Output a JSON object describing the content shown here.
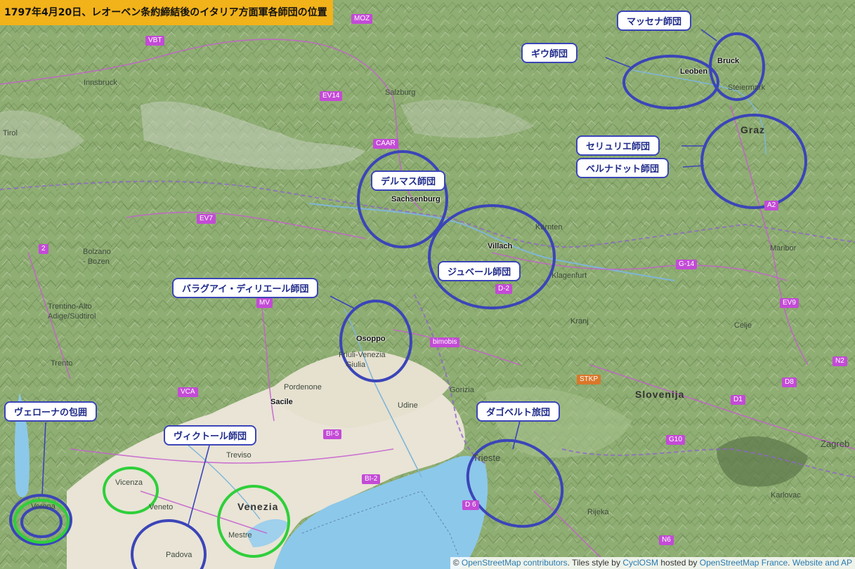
{
  "title": "1797年4月20日、レオーベン条約締結後のイタリア方面軍各師団の位置",
  "callouts": {
    "massena": "マッセナ師団",
    "guieu": "ギウ師団",
    "serurier": "セリュリエ師団",
    "bernadotte": "ベルナドット師団",
    "delmas": "デルマス師団",
    "joubert": "ジュベール師団",
    "baraguey": "バラグアイ・ディリエール師団",
    "dugoubert": "ダゴベルト旅団",
    "verona": "ヴェローナの包囲",
    "victor": "ヴィクトール師団"
  },
  "places": {
    "bruck": "Bruck",
    "leoben": "Leoben",
    "sachsenburg": "Sachsenburg",
    "villach": "Villach",
    "osoppo": "Osoppo",
    "sacile": "Sacile"
  },
  "basemap_labels": {
    "innsbruck": "Innsbruck",
    "salzburg": "Salzburg",
    "tirol": "Tirol",
    "graz": "Graz",
    "steiermark": "Steiermark",
    "karnten": "Kärnten",
    "klagenfurt": "Klagenfurt",
    "maribor": "Maribor",
    "celje": "Celje",
    "kranj": "Kranj",
    "slovenija": "Slovenija",
    "zagreb": "Zagreb",
    "karlovac": "Karlovac",
    "rijeka": "Rijeka",
    "trieste": "Trieste",
    "gorizia": "Gorizia",
    "udine": "Udine",
    "pordenone": "Pordenone",
    "friuli": "Friuli-Venezia",
    "giulia": "Giulia",
    "treviso": "Treviso",
    "venezia": "Venezia",
    "mestre": "Mestre",
    "padova": "Padova",
    "vicenza": "Vicenza",
    "veneto": "Veneto",
    "verona": "Verona",
    "trento": "Trento",
    "trentino": "Trentino-Alto",
    "adige": "Adige/Südtirol",
    "bolzano": "Bolzano",
    "bozen": "- Bozen"
  },
  "shields": {
    "moz": "MOZ",
    "vbt": "VBT",
    "ev14": "EV14",
    "caar": "CAAR",
    "ev7": "EV7",
    "s2": "2",
    "mv": "MV",
    "vca": "VCA",
    "d2": "D-2",
    "bimobis": "bimobis",
    "g14": "G-14",
    "ev9": "EV9",
    "n2": "N2",
    "d8": "D8",
    "d1": "D1",
    "g10": "G10",
    "stkp": "STKP",
    "bi5": "BI-5",
    "bi2": "BI-2",
    "d6": "D 6",
    "n6": "N6",
    "a2": "A2"
  },
  "attribution": {
    "prefix": "©",
    "osm": "OpenStreetMap contributors",
    "tiles": ". Tiles style by",
    "cyclosm": "CyclOSM",
    "hosted": "hosted by",
    "osmfr": "OpenStreetMap France",
    "sep": ".",
    "website": "Website and AP"
  },
  "colors": {
    "terrain": "#8fae73",
    "plain": "#e9e4d6",
    "sea": "#8cc8ea",
    "highlight_blue": "#3b45b8",
    "highlight_green": "#2fcf3a",
    "title_bg": "#f2b21a"
  }
}
